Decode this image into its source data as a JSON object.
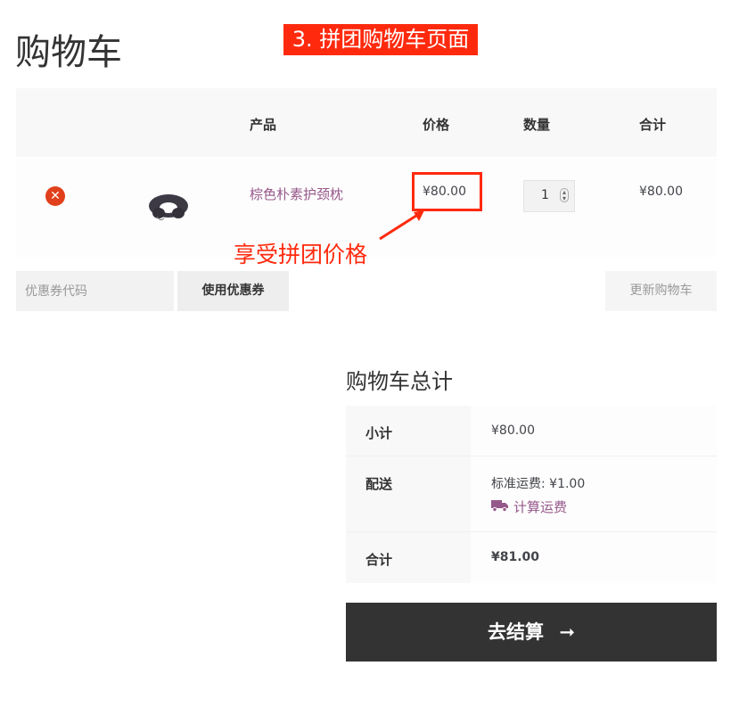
{
  "page": {
    "title": "购物车"
  },
  "banner": {
    "text": "3. 拼团购物车页面"
  },
  "table": {
    "headers": {
      "product": "产品",
      "price": "价格",
      "quantity": "数量",
      "total": "合计"
    },
    "row": {
      "remove_icon": "close-circle",
      "product_name": "棕色朴素护颈枕",
      "price": "¥80.00",
      "quantity": "1",
      "subtotal": "¥80.00"
    }
  },
  "annotation": {
    "text": "享受拼团价格"
  },
  "coupon": {
    "placeholder": "优惠券代码",
    "apply_label": "使用优惠券"
  },
  "update_cart_label": "更新购物车",
  "totals": {
    "title": "购物车总计",
    "subtotal_label": "小计",
    "subtotal_value": "¥80.00",
    "shipping_label": "配送",
    "shipping_value": "标准运费: ¥1.00",
    "calc_shipping_label": "计算运费",
    "total_label": "合计",
    "total_value": "¥81.00"
  },
  "checkout": {
    "label": "去结算",
    "arrow": "➞"
  },
  "colors": {
    "accent": "#96588a",
    "remove": "#e2401c",
    "annotation": "#ff2a0e",
    "checkout_bg": "#333333"
  }
}
